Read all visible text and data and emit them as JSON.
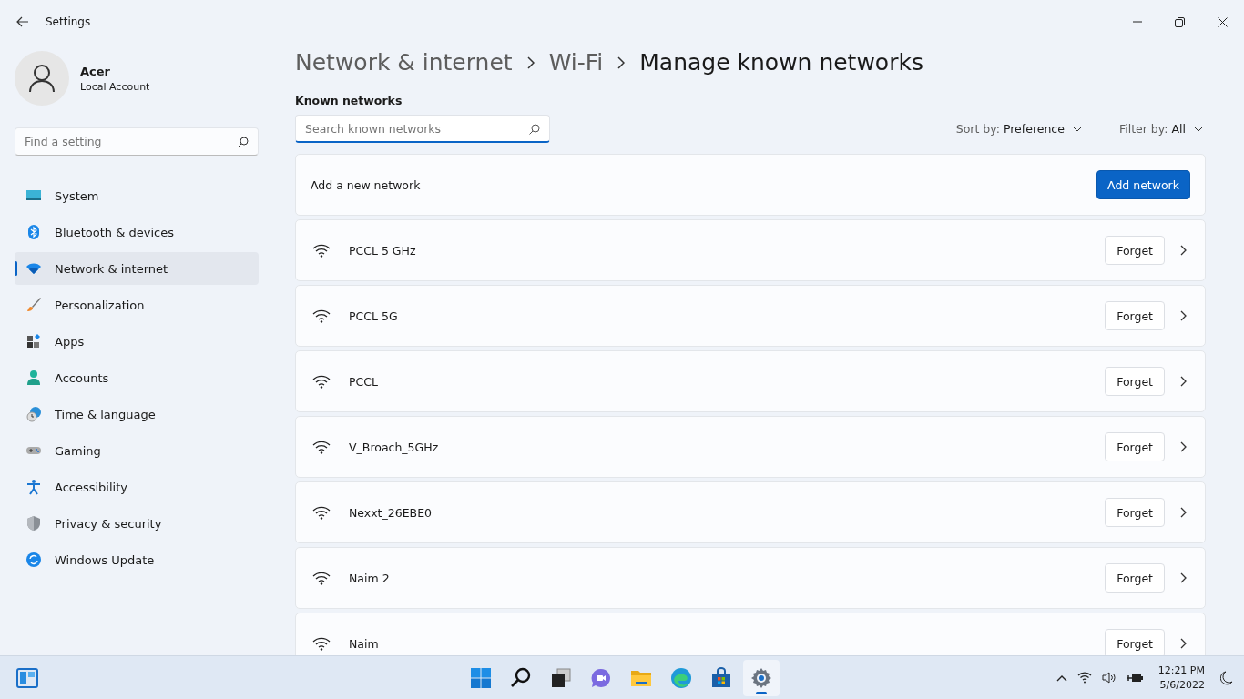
{
  "window": {
    "title": "Settings"
  },
  "account": {
    "name": "Acer",
    "type": "Local Account"
  },
  "search": {
    "placeholder": "Find a setting"
  },
  "sidebar": {
    "items": [
      {
        "label": "System",
        "selected": false
      },
      {
        "label": "Bluetooth & devices",
        "selected": false
      },
      {
        "label": "Network & internet",
        "selected": true
      },
      {
        "label": "Personalization",
        "selected": false
      },
      {
        "label": "Apps",
        "selected": false
      },
      {
        "label": "Accounts",
        "selected": false
      },
      {
        "label": "Time & language",
        "selected": false
      },
      {
        "label": "Gaming",
        "selected": false
      },
      {
        "label": "Accessibility",
        "selected": false
      },
      {
        "label": "Privacy & security",
        "selected": false
      },
      {
        "label": "Windows Update",
        "selected": false
      }
    ]
  },
  "breadcrumb": [
    "Network & internet",
    "Wi-Fi",
    "Manage known networks"
  ],
  "section_title": "Known networks",
  "network_search": {
    "placeholder": "Search known networks"
  },
  "sort": {
    "label": "Sort by:",
    "value": "Preference"
  },
  "filter": {
    "label": "Filter by:",
    "value": "All"
  },
  "add_card": {
    "label": "Add a new network",
    "button": "Add network"
  },
  "networks": [
    {
      "name": "PCCL 5 GHz",
      "button": "Forget"
    },
    {
      "name": "PCCL 5G",
      "button": "Forget"
    },
    {
      "name": "PCCL",
      "button": "Forget"
    },
    {
      "name": "V_Broach_5GHz",
      "button": "Forget"
    },
    {
      "name": "Nexxt_26EBE0",
      "button": "Forget"
    },
    {
      "name": "Naim 2",
      "button": "Forget"
    },
    {
      "name": "Naim",
      "button": "Forget"
    }
  ],
  "taskbar": {
    "apps": [
      {
        "active": false
      },
      {
        "active": false
      },
      {
        "active": false
      },
      {
        "active": false
      },
      {
        "active": false
      },
      {
        "active": false
      },
      {
        "active": false
      },
      {
        "active": true
      }
    ],
    "time": "12:21 PM",
    "date": "5/6/2022"
  }
}
